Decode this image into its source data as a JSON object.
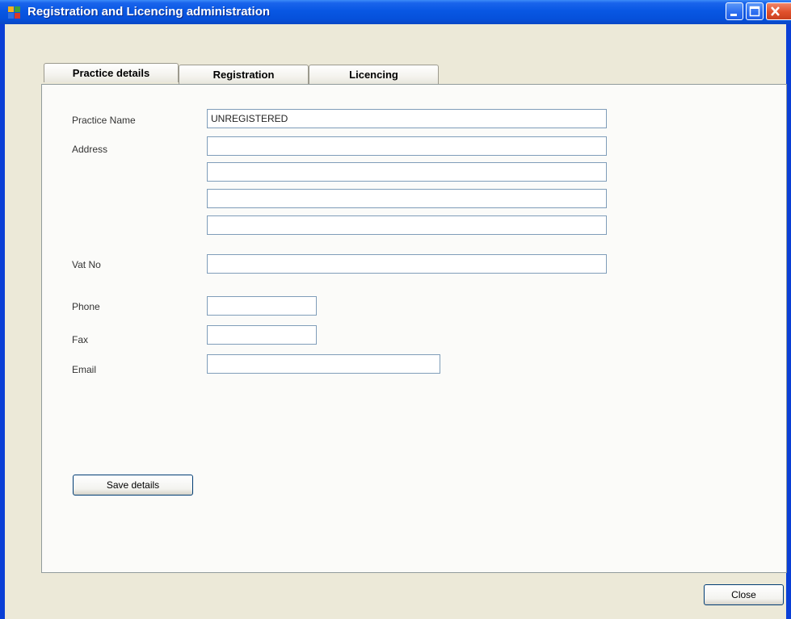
{
  "window": {
    "title": "Registration and Licencing administration",
    "controls": [
      "minimize-icon",
      "maximize-icon",
      "close-icon"
    ]
  },
  "tabs": [
    {
      "label": "Practice details",
      "active": true
    },
    {
      "label": "Registration",
      "active": false
    },
    {
      "label": "Licencing",
      "active": false
    }
  ],
  "form": {
    "practice_name": {
      "label": "Practice Name",
      "value": "UNREGISTERED"
    },
    "address": {
      "label": "Address",
      "lines": [
        "",
        "",
        "",
        ""
      ]
    },
    "vat_no": {
      "label": "Vat No",
      "value": ""
    },
    "phone": {
      "label": "Phone",
      "value": ""
    },
    "fax": {
      "label": "Fax",
      "value": ""
    },
    "email": {
      "label": "Email",
      "value": ""
    },
    "save_label": "Save details"
  },
  "footer": {
    "close_label": "Close"
  },
  "colors": {
    "titlebar": "#0857e3",
    "window_bg": "#ece9d8",
    "tab_accent": "#f2a53a",
    "field_border": "#7f9db9"
  }
}
